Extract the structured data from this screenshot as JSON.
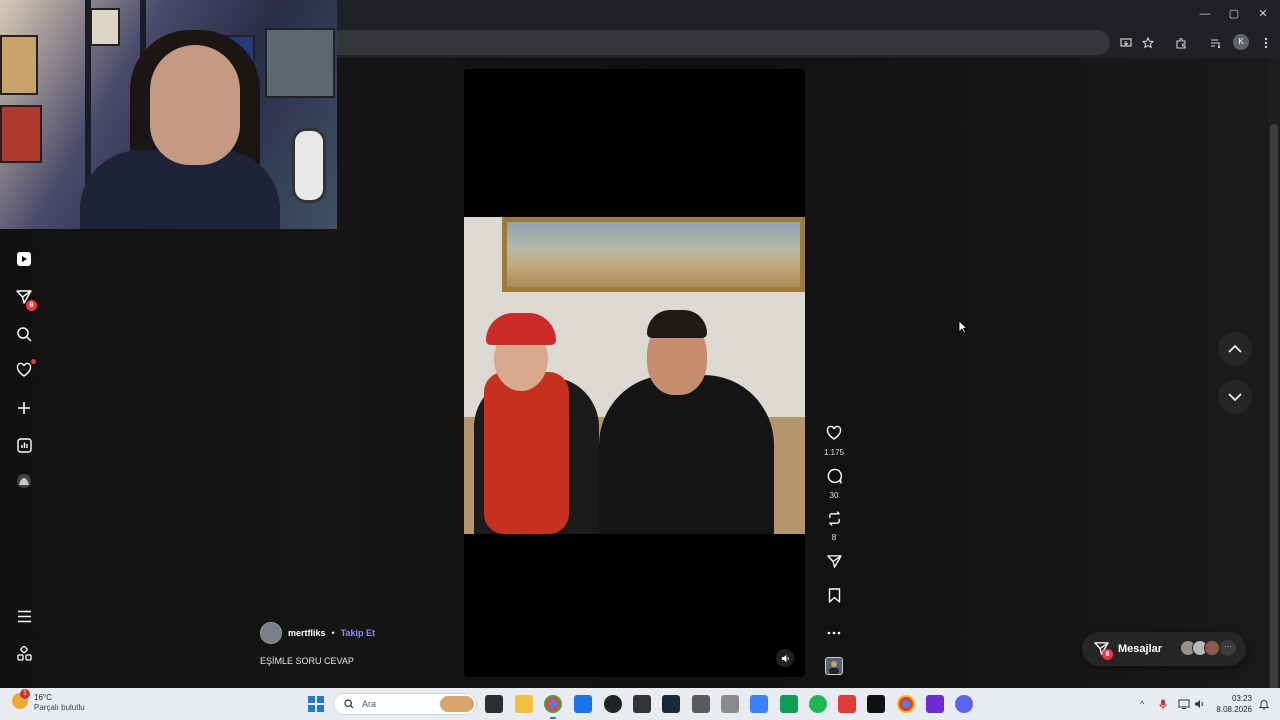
{
  "browser": {
    "window_controls": [
      "—",
      "▢",
      "✕"
    ]
  },
  "sidebar": {
    "items": [
      {
        "name": "reels",
        "icon": "play-icon"
      },
      {
        "name": "messages",
        "icon": "send-icon",
        "badge": "8"
      },
      {
        "name": "search",
        "icon": "search-icon"
      },
      {
        "name": "notifications",
        "icon": "heart-icon",
        "dot": true
      },
      {
        "name": "create",
        "icon": "plus-icon"
      },
      {
        "name": "dashboard",
        "icon": "chart-icon"
      },
      {
        "name": "profile",
        "icon": "avatar"
      },
      {
        "name": "more",
        "icon": "menu-icon"
      },
      {
        "name": "also-from-meta",
        "icon": "grid-icon"
      }
    ]
  },
  "reel": {
    "author": "mertfliks",
    "separator": "•",
    "follow_label": "Takip Et",
    "caption": "EŞİMLE SORU CEVAP",
    "likes": "1.175",
    "comments": "30",
    "reposts": "8"
  },
  "messages": {
    "label": "Mesajlar",
    "badge": "8",
    "more": "···"
  },
  "taskbar": {
    "weather_temp": "16°C",
    "weather_desc": "Parçalı bulutlu",
    "weather_badge": "1",
    "search_placeholder": "Ara",
    "time": "03:23",
    "date": "8.08.2026"
  },
  "colors": {
    "accent_follow": "#8b8cff",
    "badge": "#ff3040",
    "taskbar": "#e8ecf1"
  }
}
